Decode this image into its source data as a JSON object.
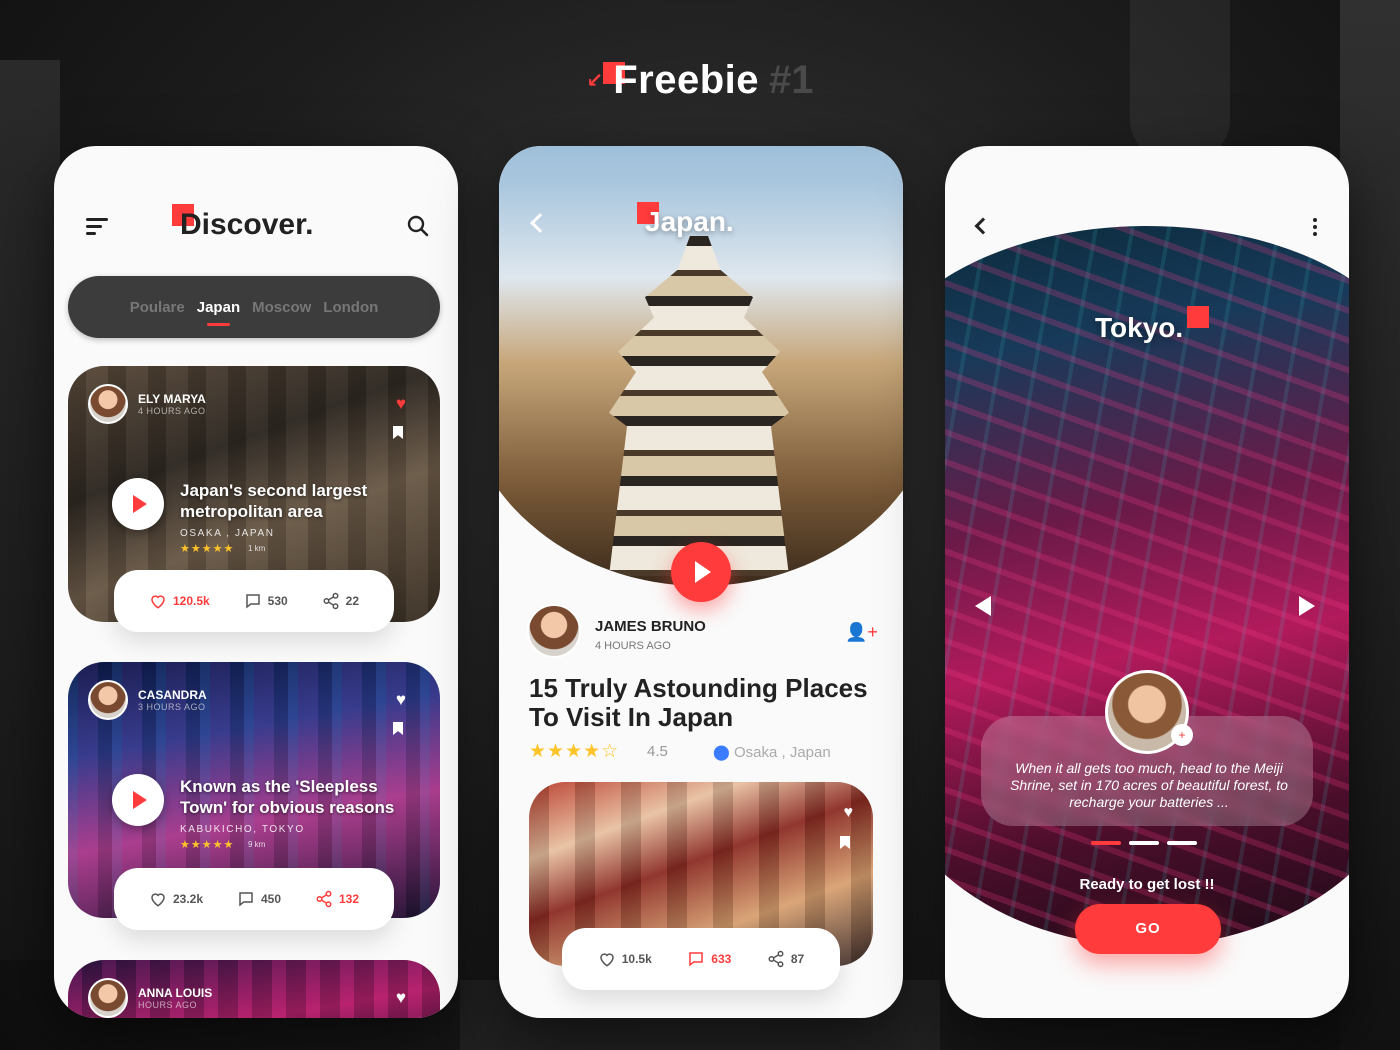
{
  "header": {
    "title": "Freebie",
    "number": "#1"
  },
  "discover": {
    "title": "Discover.",
    "tabs": [
      "Poulare",
      "Japan",
      "Moscow",
      "London"
    ],
    "active_tab": "Japan",
    "cards": [
      {
        "author": "ELY MARYA",
        "time": "4 HOURS AGO",
        "title": "Japan's second largest metropolitan area",
        "location": "OSAKA , JAPAN",
        "rating_stars": 4.5,
        "distance": "1 km",
        "stats": {
          "likes": "120.5k",
          "comments": "530",
          "shares": "22"
        },
        "liked": true
      },
      {
        "author": "CASANDRA",
        "time": "3 HOURS AGO",
        "title": "Known as the 'Sleepless Town' for obvious reasons",
        "location": "KABUKICHO, TOKYO",
        "rating_stars": 4.5,
        "distance": "9 km",
        "stats": {
          "likes": "23.2k",
          "comments": "450",
          "shares": "132"
        },
        "liked": false
      },
      {
        "author": "ANNA LOUIS",
        "time": "HOURS AGO"
      }
    ]
  },
  "japan": {
    "title": "Japan.",
    "author": "JAMES BRUNO",
    "time": "4 HOURS AGO",
    "headline": "15 Truly Astounding Places To Visit In Japan",
    "rating": "4.5",
    "location": "Osaka , Japan",
    "card_stats": {
      "likes": "10.5k",
      "comments": "633",
      "shares": "87"
    }
  },
  "tokyo": {
    "title": "Tokyo.",
    "quote": "When it all gets too much, head to the Meiji Shrine, set in 170 acres of beautiful forest, to recharge your batteries ...",
    "cta_text": "Ready to get lost !!",
    "button": "GO"
  },
  "colors": {
    "accent": "#ff3b3b",
    "star": "#ffc428",
    "pin": "#3b7bff"
  }
}
